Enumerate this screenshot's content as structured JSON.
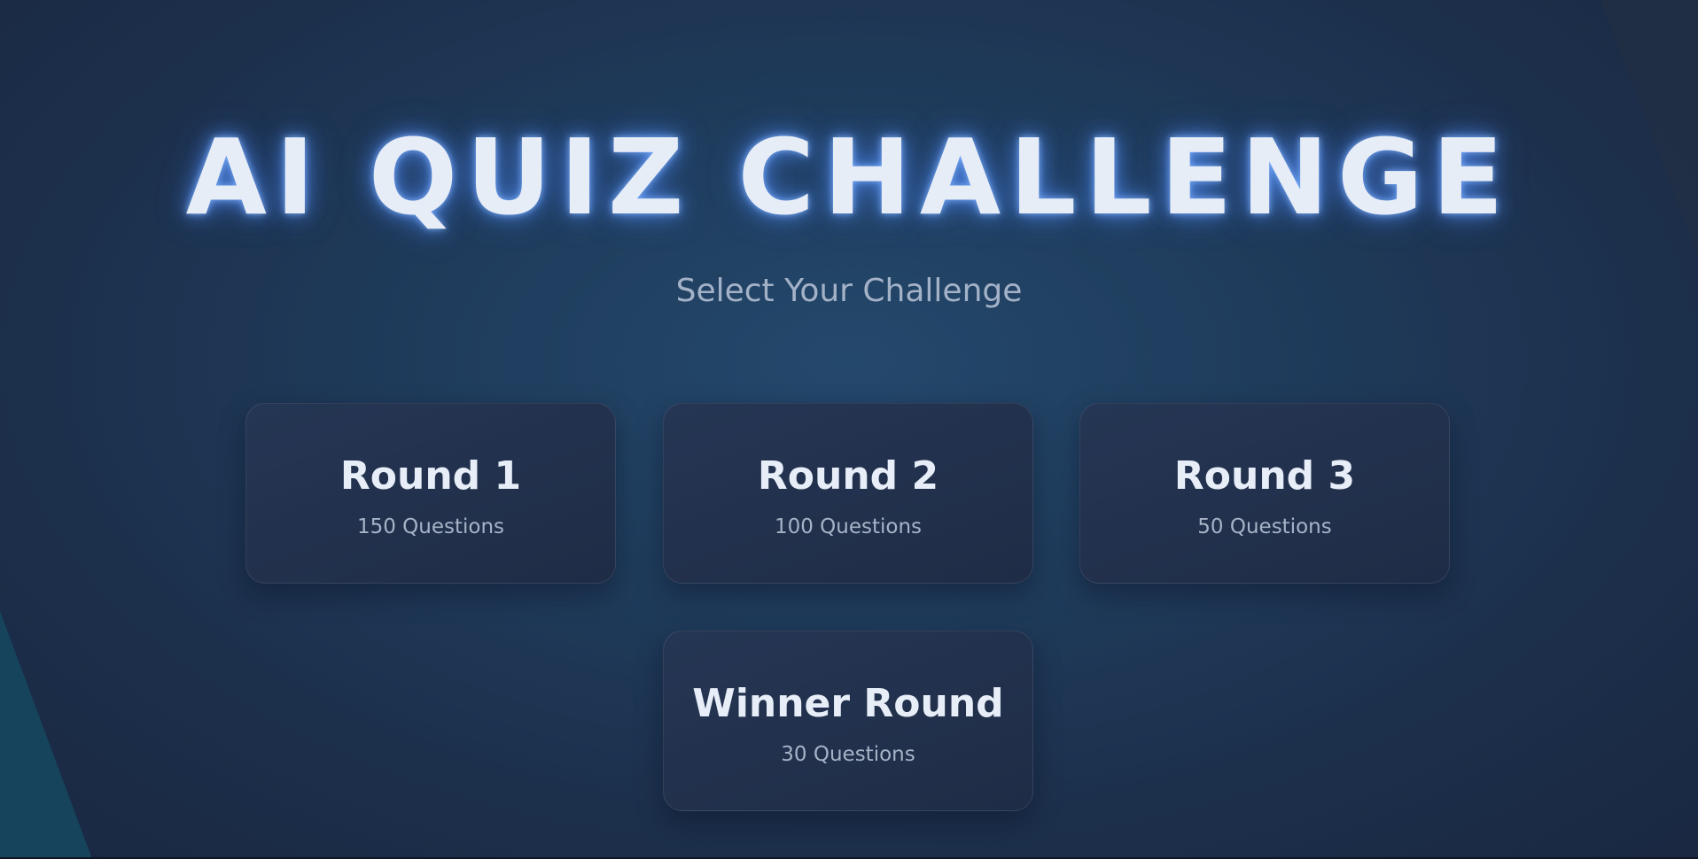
{
  "header": {
    "title": "AI QUIZ CHALLENGE",
    "subtitle": "Select Your Challenge"
  },
  "rounds": [
    {
      "title": "Round 1",
      "questions": "150 Questions"
    },
    {
      "title": "Round 2",
      "questions": "100 Questions"
    },
    {
      "title": "Round 3",
      "questions": "50 Questions"
    },
    {
      "title": "Winner Round",
      "questions": "30 Questions"
    }
  ],
  "colors": {
    "background": "#1f3c5c",
    "glow": "#5a96ff",
    "card": "#223350",
    "text": "#e8eef8",
    "muted": "#a6b3c7"
  }
}
